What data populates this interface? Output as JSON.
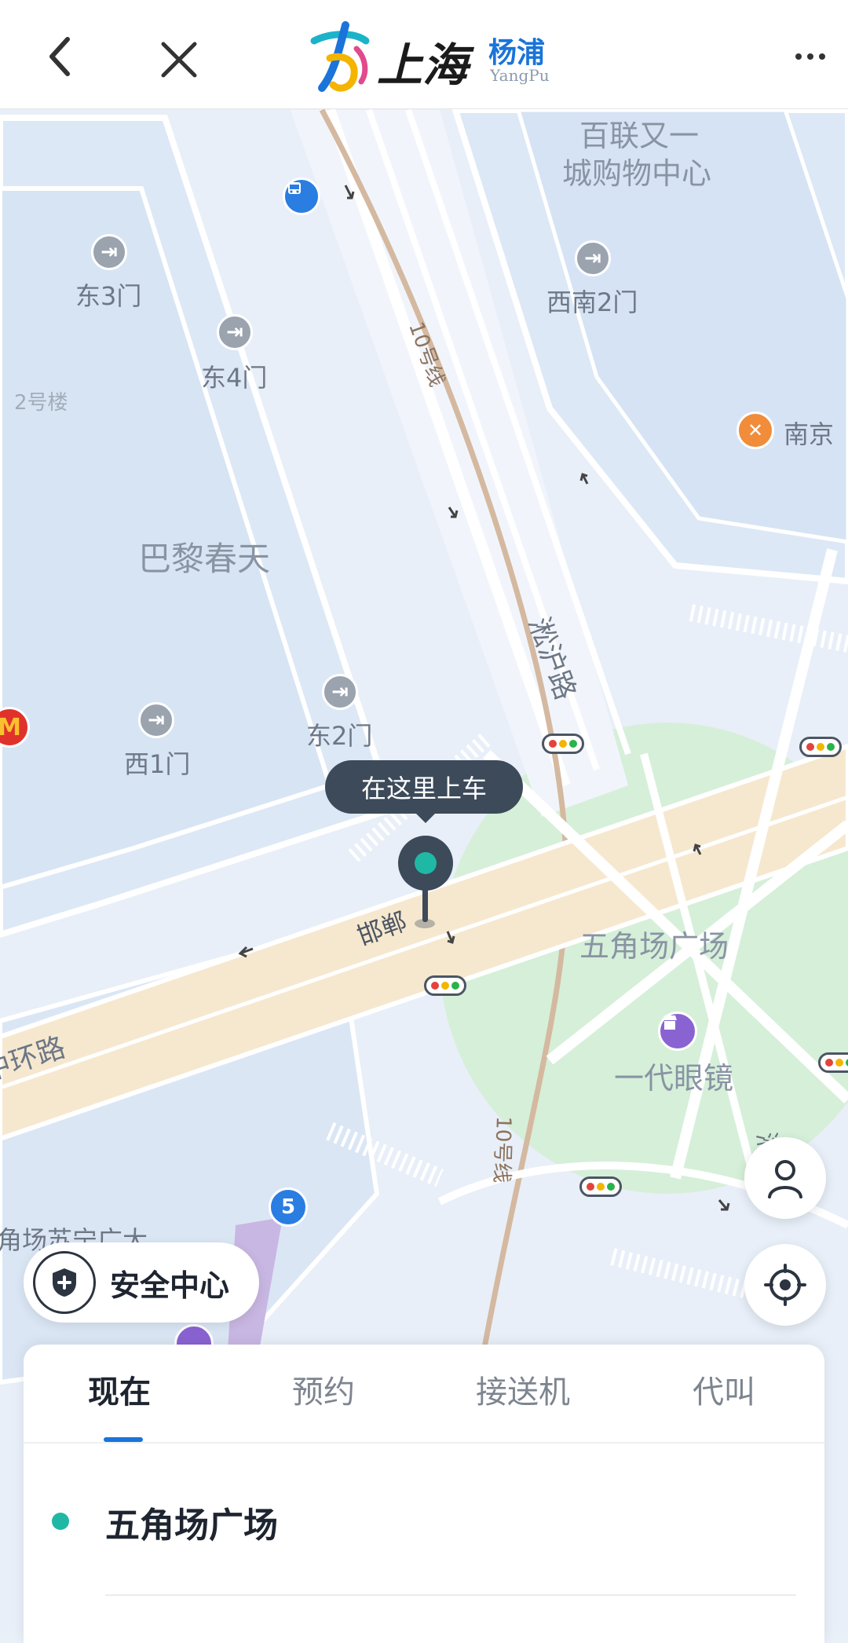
{
  "header": {
    "logo_city": "上海",
    "logo_district": "杨浦",
    "logo_district_en": "YangPu"
  },
  "map": {
    "labels": {
      "mall": "百联又一",
      "mall_line2": "城购物中心",
      "east3": "东3门",
      "southwest2": "西南2门",
      "east4": "东4门",
      "building2": "2号楼",
      "south_rest": "南京",
      "paris": "巴黎春天",
      "songhu": "淞沪路",
      "east2": "东2门",
      "west1": "西1门",
      "handan": "邯郸",
      "ring": "中环路",
      "wujiaochang": "五角场广场",
      "yidai": "一代眼镜",
      "line10_top": "10号线",
      "line10_bottom": "10号线",
      "wanda": "角场苏宁广大",
      "metro5": "5",
      "road_right": "淞沪路"
    },
    "pickup_bubble": "在这里上车",
    "colors": {
      "accent": "#1a74d9",
      "pickup": "#1fb8a5",
      "dark": "#3c4a5a",
      "park": "#d6efd9",
      "road": "#f6e8cf"
    }
  },
  "safety_center": "安全中心",
  "tabs": [
    {
      "label": "现在"
    },
    {
      "label": "预约"
    },
    {
      "label": "接送机"
    },
    {
      "label": "代叫"
    }
  ],
  "active_tab": "现在",
  "pickup_location": "五角场广场"
}
